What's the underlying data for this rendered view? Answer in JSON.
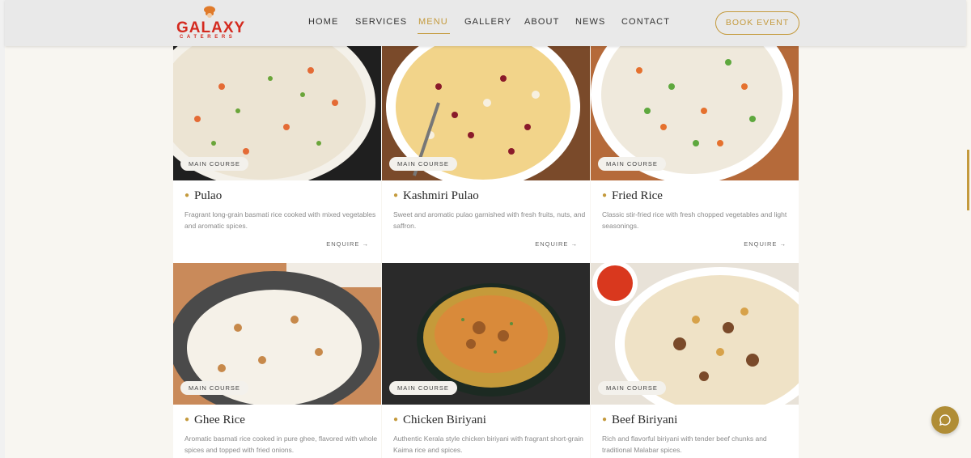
{
  "header": {
    "brand": "GALAXY",
    "brand_sub": "CATERERS",
    "nav": [
      "HOME",
      "SERVICES",
      "MENU",
      "GALLERY",
      "ABOUT",
      "NEWS",
      "CONTACT"
    ],
    "active": "MENU",
    "book_button": "BOOK EVENT"
  },
  "cards": [
    {
      "badge": "MAIN COURSE",
      "title": "Pulao",
      "desc": "Fragrant long-grain basmati rice cooked with mixed vegetables and aromatic spices.",
      "enquire": "ENQUIRE →"
    },
    {
      "badge": "MAIN COURSE",
      "title": "Kashmiri Pulao",
      "desc": "Sweet and aromatic pulao garnished with fresh fruits, nuts, and saffron.",
      "enquire": "ENQUIRE →"
    },
    {
      "badge": "MAIN COURSE",
      "title": "Fried Rice",
      "desc": "Classic stir-fried rice with fresh chopped vegetables and light seasonings.",
      "enquire": "ENQUIRE →"
    },
    {
      "badge": "MAIN COURSE",
      "title": "Ghee Rice",
      "desc": "Aromatic basmati rice cooked in pure ghee, flavored with whole spices and topped with fried onions."
    },
    {
      "badge": "MAIN COURSE",
      "title": "Chicken Biriyani",
      "desc": "Authentic Kerala style chicken biriyani with fragrant short-grain Kaima rice and spices."
    },
    {
      "badge": "MAIN COURSE",
      "title": "Beef Biriyani",
      "desc": "Rich and flavorful biriyani with tender beef chunks and traditional Malabar spices."
    }
  ],
  "colors": {
    "accent": "#c49a3d",
    "brand": "#d42a1f"
  }
}
